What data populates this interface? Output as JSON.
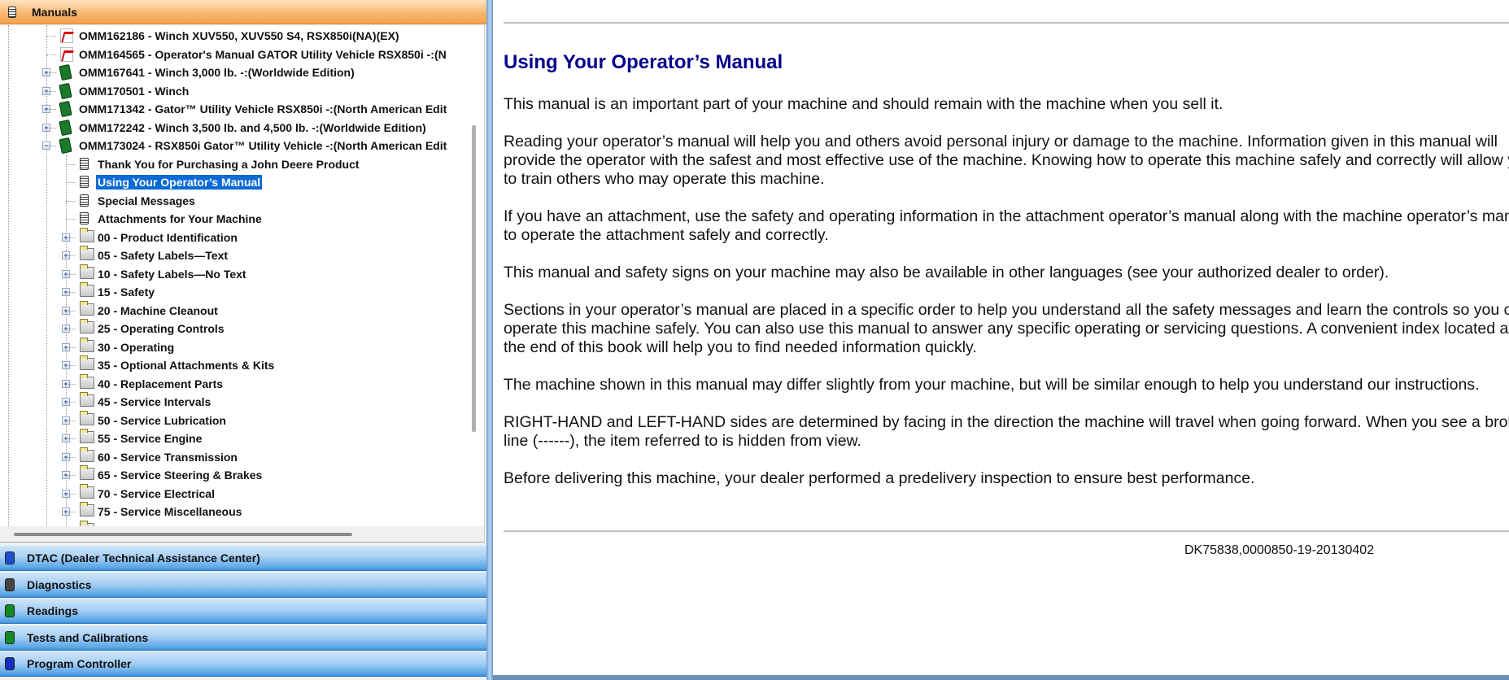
{
  "sidebar": {
    "header": {
      "label": "Manuals",
      "icon": "manual-page-icon"
    },
    "tree": [
      {
        "label": "OMM162186 - Winch XUV550, XUV550 S4, RSX850i(NA)(EX)",
        "level": 1,
        "icon": "pdf",
        "expander": "none"
      },
      {
        "label": "OMM164565 - Operator's Manual GATOR Utility Vehicle RSX850i -:(N",
        "level": 1,
        "icon": "pdf",
        "expander": "none"
      },
      {
        "label": "OMM167641 - Winch 3,000 lb. -:(Worldwide Edition)",
        "level": 1,
        "icon": "book",
        "expander": "plus"
      },
      {
        "label": "OMM170501 - Winch",
        "level": 1,
        "icon": "book",
        "expander": "plus"
      },
      {
        "label": "OMM171342 - Gator™ Utility Vehicle RSX850i -:(North American Edit",
        "level": 1,
        "icon": "book",
        "expander": "plus"
      },
      {
        "label": "OMM172242 - Winch 3,500 lb. and 4,500 lb. -:(Worldwide Edition)",
        "level": 1,
        "icon": "book",
        "expander": "plus"
      },
      {
        "label": "OMM173024 - RSX850i Gator™ Utility Vehicle -:(North American Edit",
        "level": 1,
        "icon": "book",
        "expander": "minus"
      },
      {
        "label": "Thank You for Purchasing a John Deere Product",
        "level": 2,
        "icon": "page",
        "expander": "none"
      },
      {
        "label": "Using Your Operator’s Manual",
        "level": 2,
        "icon": "page",
        "expander": "none",
        "selected": true
      },
      {
        "label": "Special Messages",
        "level": 2,
        "icon": "page",
        "expander": "none"
      },
      {
        "label": "Attachments for Your Machine",
        "level": 2,
        "icon": "page",
        "expander": "none"
      },
      {
        "label": "00 - Product Identification",
        "level": 2,
        "icon": "folder",
        "expander": "plus"
      },
      {
        "label": "05 - Safety Labels—Text",
        "level": 2,
        "icon": "folder",
        "expander": "plus"
      },
      {
        "label": "10 - Safety Labels—No Text",
        "level": 2,
        "icon": "folder",
        "expander": "plus"
      },
      {
        "label": "15 - Safety",
        "level": 2,
        "icon": "folder",
        "expander": "plus"
      },
      {
        "label": "20 - Machine Cleanout",
        "level": 2,
        "icon": "folder",
        "expander": "plus"
      },
      {
        "label": "25 - Operating Controls",
        "level": 2,
        "icon": "folder",
        "expander": "plus"
      },
      {
        "label": "30 - Operating",
        "level": 2,
        "icon": "folder",
        "expander": "plus"
      },
      {
        "label": "35 - Optional Attachments & Kits",
        "level": 2,
        "icon": "folder",
        "expander": "plus"
      },
      {
        "label": "40 - Replacement Parts",
        "level": 2,
        "icon": "folder",
        "expander": "plus"
      },
      {
        "label": "45 - Service Intervals",
        "level": 2,
        "icon": "folder",
        "expander": "plus"
      },
      {
        "label": "50 - Service Lubrication",
        "level": 2,
        "icon": "folder",
        "expander": "plus"
      },
      {
        "label": "55 - Service Engine",
        "level": 2,
        "icon": "folder",
        "expander": "plus"
      },
      {
        "label": "60 - Service Transmission",
        "level": 2,
        "icon": "folder",
        "expander": "plus"
      },
      {
        "label": "65 - Service Steering & Brakes",
        "level": 2,
        "icon": "folder",
        "expander": "plus"
      },
      {
        "label": "70 - Service Electrical",
        "level": 2,
        "icon": "folder",
        "expander": "plus"
      },
      {
        "label": "75 - Service Miscellaneous",
        "level": 2,
        "icon": "folder",
        "expander": "plus"
      },
      {
        "label": "",
        "level": 2,
        "icon": "folder",
        "expander": "none"
      }
    ],
    "nav": [
      {
        "label": "DTAC (Dealer Technical Assistance Center)",
        "icon": "dtac-icon",
        "color": "#1f4fd0"
      },
      {
        "label": "Diagnostics",
        "icon": "diagnostics-icon",
        "color": "#444444"
      },
      {
        "label": "Readings",
        "icon": "readings-icon",
        "color": "#118a22"
      },
      {
        "label": "Tests and Calibrations",
        "icon": "tests-calibrations-icon",
        "color": "#118a22"
      },
      {
        "label": "Program Controller",
        "icon": "program-controller-icon",
        "color": "#1030c0"
      }
    ]
  },
  "document": {
    "title": "Using Your Operator’s Manual",
    "title_color": "#00008b",
    "paragraphs": [
      [
        "This manual is an important part of your machine and should remain with the machine when you sell it."
      ],
      [
        "Reading your operator’s manual will help you and others avoid personal injury or damage to the machine. Information given in this manual will",
        "provide the operator with the safest and most effective use of the machine. Knowing how to operate this machine safely and correctly will allow you",
        "to train others who may operate this machine."
      ],
      [
        "If you have an attachment, use the safety and operating information in the attachment operator’s manual along with the machine operator’s manual",
        "to operate the attachment safely and correctly."
      ],
      [
        "This manual and safety signs on your machine may also be available in other languages (see your authorized dealer to order)."
      ],
      [
        "Sections in your operator’s manual are placed in a specific order to help you understand all the safety messages and learn the controls so you can",
        "operate this machine safely. You can also use this manual to answer any specific operating or servicing questions. A convenient index located at",
        "the end of this book will help you to find needed information quickly."
      ],
      [
        "The machine shown in this manual may differ slightly from your machine, but will be similar enough to help you understand our instructions."
      ],
      [
        "RIGHT-HAND and LEFT-HAND sides are determined by facing in the direction the machine will travel when going forward. When you see a broken",
        "line (------), the item referred to is hidden from view."
      ],
      [
        "Before delivering this machine, your dealer performed a predelivery inspection to ensure best performance."
      ]
    ],
    "doc_id": "DK75838,0000850-19-20130402"
  }
}
